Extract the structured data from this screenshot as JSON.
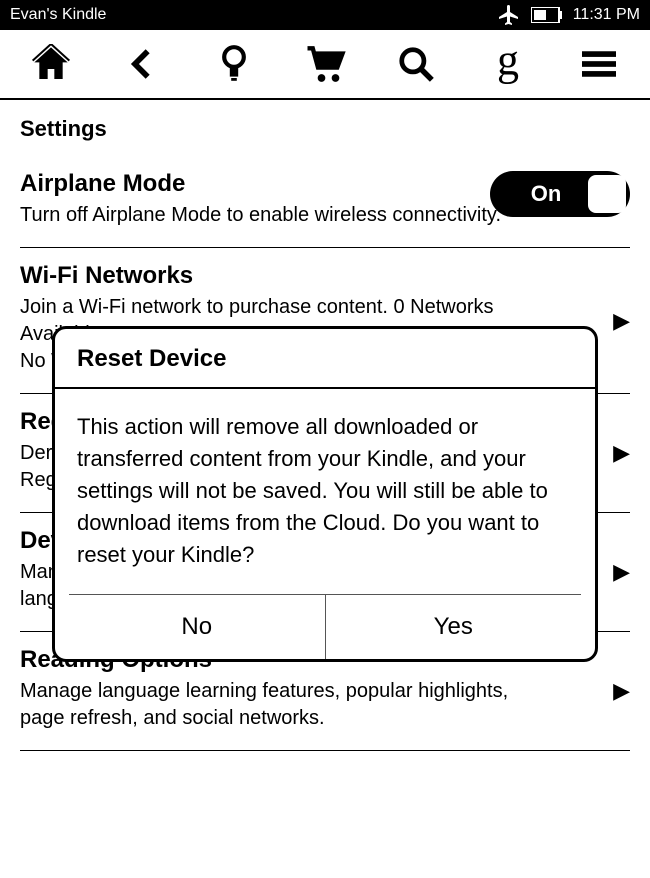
{
  "statusbar": {
    "title": "Evan's Kindle",
    "time": "11:31 PM"
  },
  "page": {
    "section_label": "Settings"
  },
  "settings": {
    "airplane": {
      "title": "Airplane Mode",
      "desc": "Turn off Airplane Mode to enable wireless connectivity.",
      "toggle_label": "On"
    },
    "wifi": {
      "title": "Wi-Fi Networks",
      "desc_line1": "Join a Wi-Fi network to purchase content. 0 Networks",
      "desc_line2": "Available",
      "desc_caption": "No Wi-Fi"
    },
    "registration": {
      "title": "Registration",
      "desc": "Deregister this Kindle from an Amazon account.",
      "caption": "Registered User: Evan"
    },
    "device": {
      "title": "Device Options",
      "desc": "Manage your device settings, set a passcode, change language, dictionaries, and personalize your Kindle."
    },
    "reading": {
      "title": "Reading Options",
      "desc": "Manage language learning features, popular highlights, page refresh, and social networks."
    }
  },
  "dialog": {
    "title": "Reset Device",
    "body": "This action will remove all downloaded or transferred content from your Kindle, and your settings will not be saved. You will still be able to download items from the Cloud. Do you want to reset your Kindle?",
    "no_label": "No",
    "yes_label": "Yes"
  }
}
